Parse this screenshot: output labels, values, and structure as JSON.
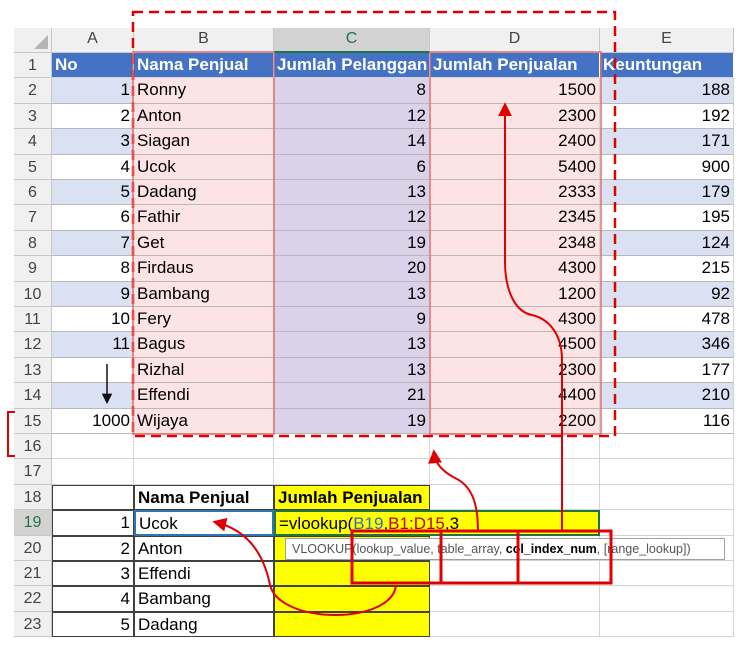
{
  "spreadsheet": {
    "column_headers": [
      "A",
      "B",
      "C",
      "D",
      "E"
    ],
    "selected_column": "C",
    "selected_row": 19,
    "row_numbers": [
      1,
      2,
      3,
      4,
      5,
      6,
      7,
      8,
      9,
      10,
      11,
      12,
      13,
      14,
      15,
      16,
      17,
      18,
      19,
      20,
      21,
      22,
      23
    ],
    "main_table": {
      "headers": [
        "No",
        "Nama Penjual",
        "Jumlah Pelanggan",
        "Jumlah Penjualan",
        "Keuntungan"
      ],
      "rows": [
        [
          "1",
          "Ronny",
          "8",
          "1500",
          "188"
        ],
        [
          "2",
          "Anton",
          "12",
          "2300",
          "192"
        ],
        [
          "3",
          "Siagan",
          "14",
          "2400",
          "171"
        ],
        [
          "4",
          "Ucok",
          "6",
          "5400",
          "900"
        ],
        [
          "5",
          "Dadang",
          "13",
          "2333",
          "179"
        ],
        [
          "6",
          "Fathir",
          "12",
          "2345",
          "195"
        ],
        [
          "7",
          "Get",
          "19",
          "2348",
          "124"
        ],
        [
          "8",
          "Firdaus",
          "20",
          "4300",
          "215"
        ],
        [
          "9",
          "Bambang",
          "13",
          "1200",
          "92"
        ],
        [
          "10",
          "Fery",
          "9",
          "4300",
          "478"
        ],
        [
          "11",
          "Bagus",
          "13",
          "4500",
          "346"
        ],
        [
          "",
          "Rizhal",
          "13",
          "2300",
          "177"
        ],
        [
          "",
          "Effendi",
          "21",
          "4400",
          "210"
        ],
        [
          "1000",
          "Wijaya",
          "19",
          "2200",
          "116"
        ]
      ]
    },
    "lookup_table": {
      "headers": [
        "Nama Penjual",
        "Jumlah Penjualan"
      ],
      "rows": [
        [
          "1",
          "Ucok"
        ],
        [
          "2",
          "Anton"
        ],
        [
          "3",
          "Effendi"
        ],
        [
          "4",
          "Bambang"
        ],
        [
          "5",
          "Dadang"
        ]
      ]
    },
    "formula": {
      "prefix": "=vlookup(",
      "ref1": "B19",
      "sep1": ",",
      "ref2": "B1:D15",
      "rest": ",3"
    },
    "tooltip": {
      "fn": "VLOOKUP(",
      "arg1": "lookup_value",
      "sep": ", ",
      "arg2": "table_array",
      "arg3": "col_index_num",
      "arg4": "[range_lookup])"
    }
  },
  "colors": {
    "header_blue": "#4472c4",
    "band_blue": "#d9e1f2",
    "band_pink": "#fce4e4",
    "band_lavender": "#d9d2e9",
    "highlight_yellow": "#ffff00",
    "annotation_red": "#e00000",
    "excel_green": "#217346"
  }
}
